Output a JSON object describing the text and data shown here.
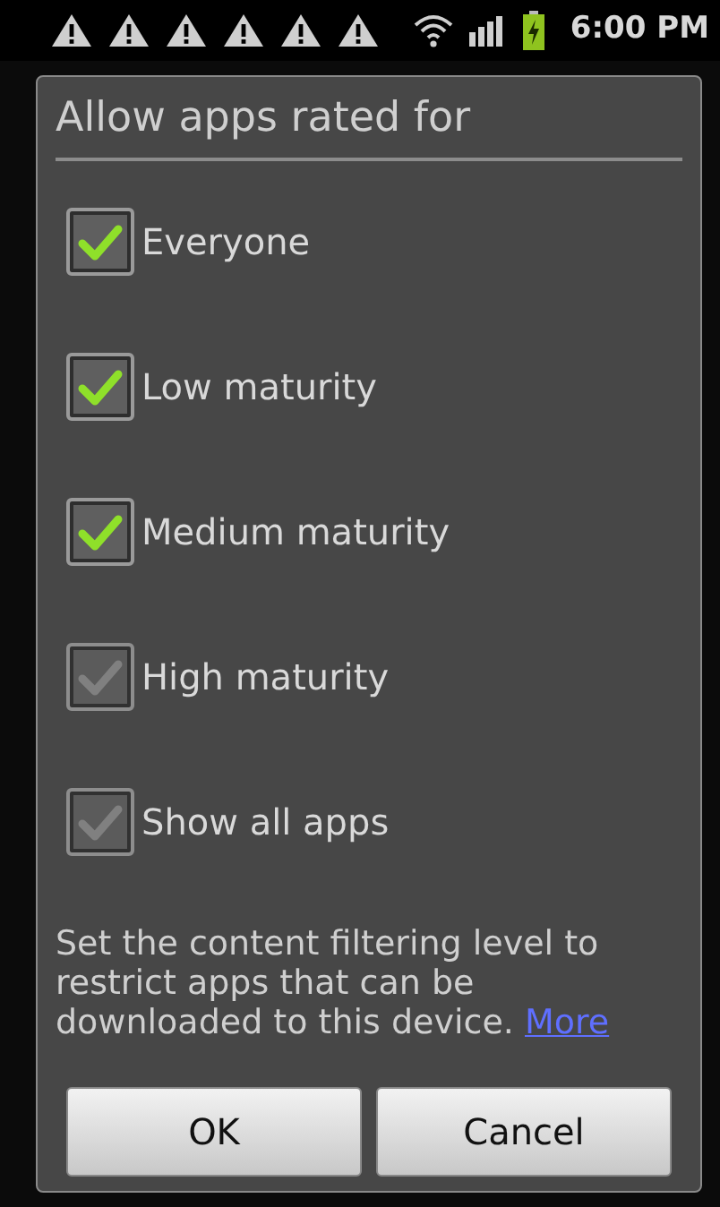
{
  "status_bar": {
    "notifications": [
      {
        "kind": "warning"
      },
      {
        "kind": "warning"
      },
      {
        "kind": "warning"
      },
      {
        "kind": "warning"
      },
      {
        "kind": "warning"
      },
      {
        "kind": "warning"
      }
    ],
    "time": "6:00 PM"
  },
  "dialog": {
    "title": "Allow apps rated for",
    "options": [
      {
        "label": "Everyone",
        "checked": true,
        "disabled": false
      },
      {
        "label": "Low maturity",
        "checked": true,
        "disabled": false
      },
      {
        "label": "Medium maturity",
        "checked": true,
        "disabled": false
      },
      {
        "label": "High maturity",
        "checked": true,
        "disabled": true
      },
      {
        "label": "Show all apps",
        "checked": true,
        "disabled": true
      }
    ],
    "note": {
      "text": "Set the content filtering level to restrict apps that can be downloaded to this device.",
      "link": "More"
    },
    "buttons": [
      "OK",
      "Cancel"
    ]
  }
}
